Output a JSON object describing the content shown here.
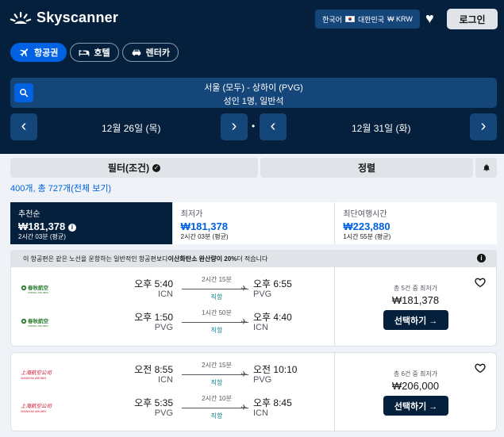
{
  "header": {
    "logo_text": "Skyscanner",
    "locale_lang": "한국어",
    "locale_country": "대한민국",
    "locale_currency": "₩ KRW",
    "login_label": "로그인"
  },
  "tabs": [
    {
      "label": "항공권",
      "icon": "plane-icon"
    },
    {
      "label": "호텔",
      "icon": "bed-icon"
    },
    {
      "label": "렌터카",
      "icon": "car-icon"
    }
  ],
  "search": {
    "route": "서울 (모두) - 상하이 (PVG)",
    "passengers": "성인 1명, 일반석"
  },
  "dates": {
    "depart": "12월 26일 (목)",
    "return": "12월 31일 (화)",
    "separator": "•"
  },
  "filters": {
    "filter_label": "필터(조건)",
    "sort_label": "정렬"
  },
  "results": {
    "count_text": "400개, 총 727개(전체 보기)"
  },
  "sort_tabs": [
    {
      "label": "추천순",
      "price": "₩181,378",
      "duration": "2시간 03분 (평균)"
    },
    {
      "label": "최저가",
      "price": "₩181,378",
      "duration": "2시간 03분 (평균)"
    },
    {
      "label": "최단여행시간",
      "price": "₩223,880",
      "duration": "1시간 55분 (평균)"
    }
  ],
  "eco_banner": {
    "prefix": "이 항공편은 같은 노선을 운항하는 일반적인 항공편보다 ",
    "highlight": "이산화탄소 완산량이 20%",
    "suffix": " 더 적습니다"
  },
  "flights": [
    {
      "airline": "SPRING AIRLINES",
      "legs": [
        {
          "dep_time": "오후 5:40",
          "dep_code": "ICN",
          "duration": "2시간 15분",
          "stops": "직항",
          "arr_time": "오후 6:55",
          "arr_code": "PVG"
        },
        {
          "dep_time": "오후 1:50",
          "dep_code": "PVG",
          "duration": "1시간 50분",
          "stops": "직항",
          "arr_time": "오후 4:40",
          "arr_code": "ICN"
        }
      ],
      "deal_count": "총 5건 중 최저가",
      "price": "₩181,378",
      "select_label": "선택하기 →"
    },
    {
      "airline": "SHANGHAI AIRLINES",
      "legs": [
        {
          "dep_time": "오전 8:55",
          "dep_code": "ICN",
          "duration": "2시간 15분",
          "stops": "직항",
          "arr_time": "오전 10:10",
          "arr_code": "PVG"
        },
        {
          "dep_time": "오후 5:35",
          "dep_code": "PVG",
          "duration": "2시간 10분",
          "stops": "직항",
          "arr_time": "오후 8:45",
          "arr_code": "ICN"
        }
      ],
      "deal_count": "총 6건 중 최저가",
      "price": "₩206,000",
      "select_label": "선택하기 →"
    }
  ],
  "colors": {
    "navy": "#05203c",
    "header_panel": "#154679",
    "accent_blue": "#0062e3",
    "direct_green": "#0c838a",
    "spring_green": "#2e7d32",
    "shanghai_red": "#c8102e"
  }
}
